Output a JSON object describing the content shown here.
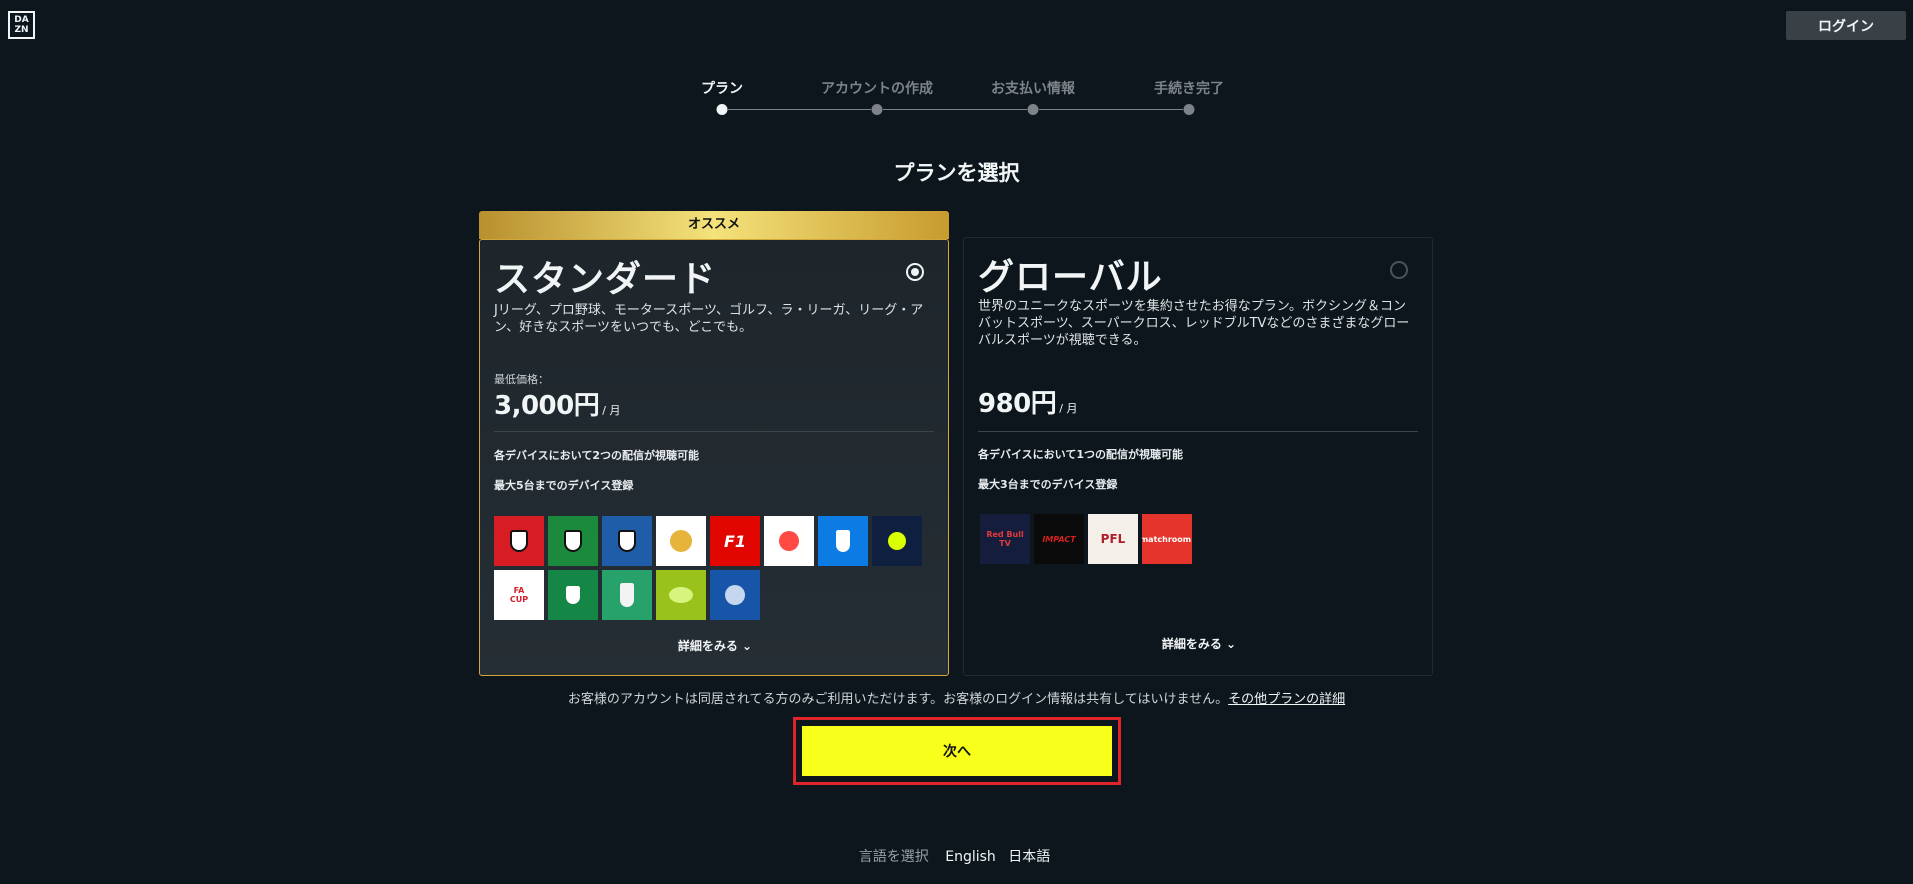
{
  "header": {
    "logo_letters": [
      "DA",
      "ZN"
    ],
    "login_label": "ログイン"
  },
  "stepper": {
    "steps": [
      {
        "label": "プラン",
        "active": true
      },
      {
        "label": "アカウントの作成",
        "active": false
      },
      {
        "label": "お支払い情報",
        "active": false
      },
      {
        "label": "手続き完了",
        "active": false
      }
    ]
  },
  "title": "プランを選択",
  "plans": [
    {
      "badge": "オススメ",
      "name": "スタンダード",
      "selected": true,
      "description": "Jリーグ、プロ野球、モータースポーツ、ゴルフ、ラ・リーガ、リーグ・アン、好きなスポーツをいつでも、どこでも。",
      "min_price_label": "最低価格：",
      "price": "3,000円",
      "per": "/ 月",
      "features": [
        "各デバイスにおいて2つの配信が視聴可能",
        "最大5台までのデバイス登録"
      ],
      "logos": [
        "J1 2023",
        "J2 2023",
        "J3 2023",
        "AFC Champions League",
        "F1",
        "LaLiga Santander",
        "Serie A",
        "Ligue 1",
        "Emirates FA CUP",
        "Carabao Cup",
        "DFB Pokal",
        "Liga Portugal",
        "UEFA Champions League"
      ],
      "more_label": "詳細をみる ⌄"
    },
    {
      "name": "グローバル",
      "selected": false,
      "description": "世界のユニークなスポーツを集約させたお得なプラン。ボクシング＆コンバットスポーツ、スーパークロス、レッドブルTVなどのさまざまなグローバルスポーツが視聴できる。",
      "price": "980円",
      "per": "/ 月",
      "features": [
        "各デバイスにおいて1つの配信が視聴可能",
        "最大3台までのデバイス登録"
      ],
      "logos": [
        "Red Bull TV",
        "IMPACT",
        "PFL",
        "matchroom."
      ],
      "more_label": "詳細をみる ⌄"
    }
  ],
  "note": {
    "text": "お客様のアカウントは同居されてる方のみご利用いただけます。お客様のログイン情報は共有してはいけません。",
    "link": "その他プランの詳細"
  },
  "next_label": "次へ",
  "language": {
    "label": "言語を選択",
    "options": [
      "English",
      "日本語"
    ]
  },
  "colors": {
    "background": "#0c161c",
    "accent_yellow": "#f7ff1a",
    "gold": "#d3a737",
    "highlight_red": "#e0242b"
  }
}
